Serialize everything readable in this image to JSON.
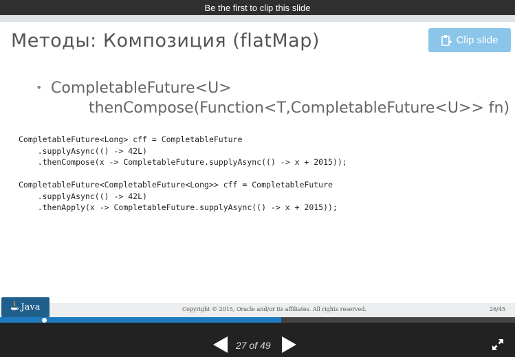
{
  "topbar": {
    "message": "Be the first to clip this slide"
  },
  "slide": {
    "title": "Методы: Композиция (flatMap)",
    "clip_button_label": "Clip slide",
    "bullet_line1": "CompletableFuture<U>",
    "bullet_line2": "thenCompose(Function<T,CompletableFuture<U>> fn)",
    "code_block_1": "CompletableFuture<Long> cff = CompletableFuture\n    .supplyAsync(() -> 42L)\n    .thenCompose(x -> CompletableFuture.supplyAsync(() -> x + 2015));",
    "code_block_2": "CompletableFuture<CompletableFuture<Long>> cff = CompletableFuture\n    .supplyAsync(() -> 42L)\n    .thenApply(x -> CompletableFuture.supplyAsync(() -> x + 2015));",
    "footer": {
      "logo_text": "Java",
      "copyright": "Copyright © 2015, Oracle and/or its affiliates. All rights reserved.",
      "page": "26/45"
    }
  },
  "player": {
    "progress_fraction": 0.5455,
    "knob_fraction": 0.085,
    "counter": "27 of 49",
    "colors": {
      "accent": "#1e7bbf",
      "clip_button": "#8cc5ea"
    }
  },
  "icons": {
    "clip": "clip-icon",
    "prev": "triangle-left-icon",
    "next": "triangle-right-icon",
    "fullscreen": "expand-arrows-icon",
    "java": "java-cup-icon"
  }
}
